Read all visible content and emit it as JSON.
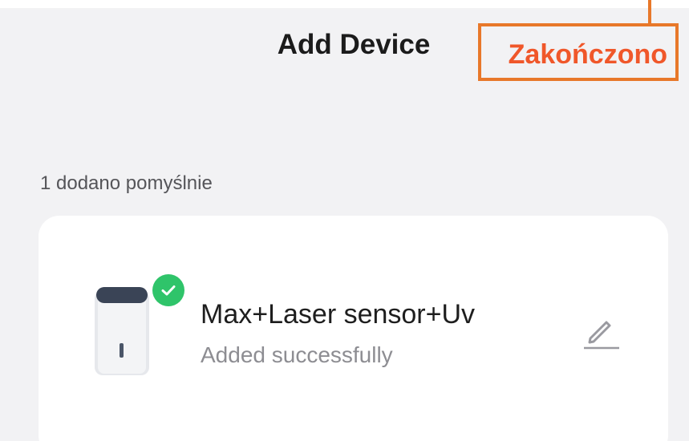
{
  "header": {
    "title": "Add Device",
    "done_label": "Zakończono"
  },
  "section": {
    "label": "1 dodano pomyślnie"
  },
  "device": {
    "name": "Max+Laser sensor+Uv",
    "status": "Added successfully",
    "icon": "sensor-device-icon"
  },
  "colors": {
    "accent": "#f0572a",
    "callout": "#e8782a",
    "success": "#2fc46a"
  }
}
